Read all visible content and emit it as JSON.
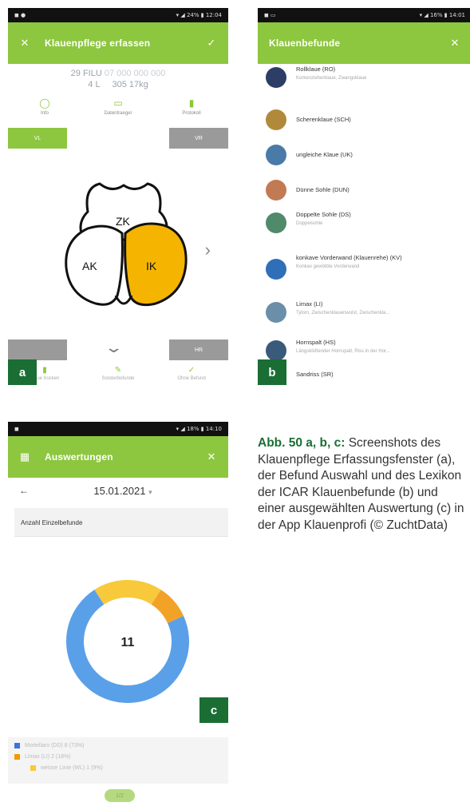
{
  "phone_a": {
    "status_right": "▾ ◢ 24% ▮ 12:04",
    "appbar": {
      "close": "✕",
      "title": "Klauenpflege erfassen",
      "check": "✓"
    },
    "cow": {
      "line1": "29 FILU",
      "line1_blur": "07 000 000 000",
      "line2": "4 L",
      "line2_b": "305 17kg"
    },
    "icons": [
      {
        "glyph": "◯",
        "label": "Info"
      },
      {
        "glyph": "▭",
        "label": "Datentraeger"
      },
      {
        "glyph": "▮",
        "label": "Protokoll"
      }
    ],
    "tab_left": "VL",
    "tab_right": "VR",
    "zones": {
      "zk": "ZK",
      "ak": "AK",
      "ik": "IK"
    },
    "tag": "a",
    "bottom": [
      {
        "glyph": "▮",
        "label": "Klaue trocken"
      },
      {
        "glyph": "✎",
        "label": "Sonderbefunde"
      },
      {
        "glyph": "✓",
        "label": "Ohne Befund"
      }
    ],
    "btn_right_bottom": "HR"
  },
  "phone_b": {
    "status_right": "▾ ◢ 16% ▮ 14:01",
    "appbar": {
      "title": "Klauenbefunde",
      "close": "✕"
    },
    "findings": [
      {
        "title": "Rollklaue (RO)",
        "sub": "Korkenzieherklaue, Zwangsklaue",
        "color": "#2c3e66"
      },
      {
        "title": "Scherenklaue (SCH)",
        "sub": "",
        "color": "#b08a3a"
      },
      {
        "title": "ungleiche Klaue (UK)",
        "sub": "",
        "color": "#4a7ba8"
      },
      {
        "title": "Dünne Sohle (DUN)",
        "sub": "",
        "color": "#c27a55"
      },
      {
        "title": "Doppelte Sohle (DS)",
        "sub": "Doppelsohle",
        "color": "#4f8a6b"
      },
      {
        "title": "konkave Vorderwand (Klauenrehe) (KV)",
        "sub": "Konkav gewölbte Vorderwand",
        "color": "#2f6fb8"
      },
      {
        "title": "Limax (LI)",
        "sub": "Tylom, Zwischenklauenwulst, Zwischenkla...",
        "color": "#6b8fa8"
      },
      {
        "title": "Hornspalt (HS)",
        "sub": "Längsklüftender Hornspalt, Riss in der Hor...",
        "color": "#3a5a7a"
      },
      {
        "title": "Sandriss (SR)",
        "sub": "",
        "color": "#8a8a8a"
      }
    ],
    "tag": "b"
  },
  "phone_c": {
    "status_right": "▾ ◢ 18% ▮ 14:10",
    "appbar": {
      "icon": "▦",
      "title": "Auswertungen",
      "close": "✕"
    },
    "back": "←",
    "date": "15.01.2021",
    "date_caret": "▾",
    "section": "Anzahl Einzelbefunde",
    "center_value": "11",
    "chart_colors": {
      "blue": "#5aa0e8",
      "orange": "#f2a227",
      "yellow": "#f8c93a"
    },
    "legend": [
      {
        "color": "#3b74e0",
        "label": "Mortellaro (DD) 8 (73%)"
      },
      {
        "color": "#f29a00",
        "label": "Limax (LI) 2 (18%)"
      },
      {
        "color": "#f8c93a",
        "label": "weisse Linie (WL) 1 (9%)"
      }
    ],
    "pill": "1/2",
    "tag": "c"
  },
  "chart_data": {
    "type": "pie",
    "title": "Anzahl Einzelbefunde",
    "total": 11,
    "slices": [
      {
        "label": "Mortellaro (DD)",
        "value": 8
      },
      {
        "label": "Limax (LI)",
        "value": 2
      },
      {
        "label": "weisse Linie (WL)",
        "value": 1
      }
    ]
  },
  "caption": {
    "bold": "Abb. 50 a, b, c:",
    "text": " Screenshots des Klauenpflege Erfassungsfenster (a), der Befund Auswahl und des Lexikon der ICAR Klauenbefunde (b) und einer ausgewählten Auswertung (c) in der App Klauenprofi (© ZuchtData)"
  }
}
